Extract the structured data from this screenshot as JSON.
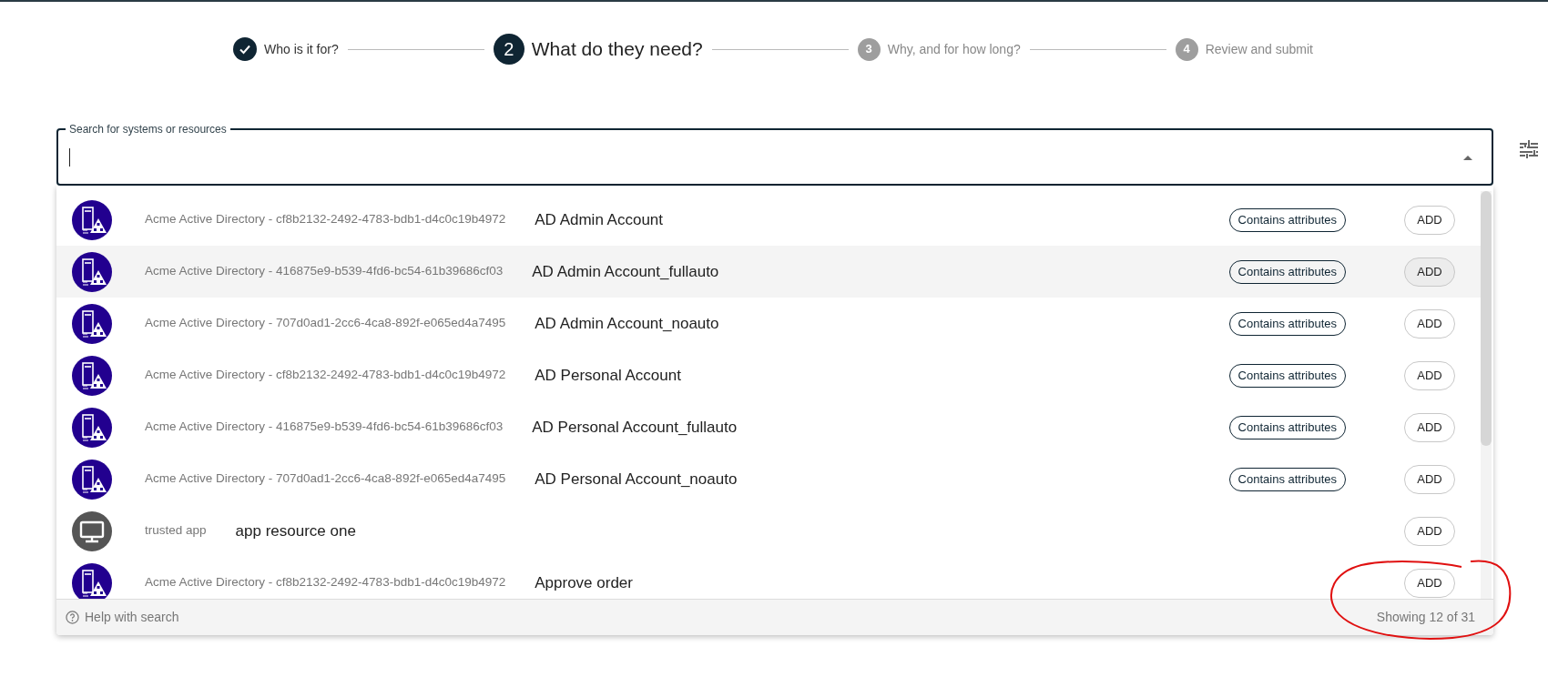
{
  "stepper": {
    "steps": [
      {
        "done": true,
        "current": false,
        "label": "Who is it for?"
      },
      {
        "done": false,
        "current": true,
        "number": "2",
        "label": "What do they need?"
      },
      {
        "done": false,
        "current": false,
        "number": "3",
        "label": "Why, and for how long?"
      },
      {
        "done": false,
        "current": false,
        "number": "4",
        "label": "Review and submit"
      }
    ]
  },
  "search": {
    "label": "Search for systems or resources",
    "expanded": true
  },
  "results": [
    {
      "kind": "directory",
      "source": "Acme Active Directory - cf8b2132-2492-4783-bdb1-d4c0c19b4972",
      "name": "AD Admin Account",
      "badge": "Contains attributes",
      "button": "ADD",
      "highlighted": false
    },
    {
      "kind": "directory",
      "source": "Acme Active Directory - 416875e9-b539-4fd6-bc54-61b39686cf03",
      "name": "AD Admin Account_fullauto",
      "badge": "Contains attributes",
      "button": "ADD",
      "highlighted": true
    },
    {
      "kind": "directory",
      "source": "Acme Active Directory - 707d0ad1-2cc6-4ca8-892f-e065ed4a7495",
      "name": "AD Admin Account_noauto",
      "badge": "Contains attributes",
      "button": "ADD",
      "highlighted": false
    },
    {
      "kind": "directory",
      "source": "Acme Active Directory - cf8b2132-2492-4783-bdb1-d4c0c19b4972",
      "name": "AD Personal Account",
      "badge": "Contains attributes",
      "button": "ADD",
      "highlighted": false
    },
    {
      "kind": "directory",
      "source": "Acme Active Directory - 416875e9-b539-4fd6-bc54-61b39686cf03",
      "name": "AD Personal Account_fullauto",
      "badge": "Contains attributes",
      "button": "ADD",
      "highlighted": false
    },
    {
      "kind": "directory",
      "source": "Acme Active Directory - 707d0ad1-2cc6-4ca8-892f-e065ed4a7495",
      "name": "AD Personal Account_noauto",
      "badge": "Contains attributes",
      "button": "ADD",
      "highlighted": false
    },
    {
      "kind": "app",
      "source": "trusted app",
      "name": "app resource one",
      "button": "ADD",
      "highlighted": false
    },
    {
      "kind": "directory",
      "source": "Acme Active Directory - cf8b2132-2492-4783-bdb1-d4c0c19b4972",
      "name": "Approve order",
      "button": "ADD",
      "highlighted": false
    }
  ],
  "footer": {
    "help": "Help with search",
    "count": "Showing 12 of 31"
  }
}
